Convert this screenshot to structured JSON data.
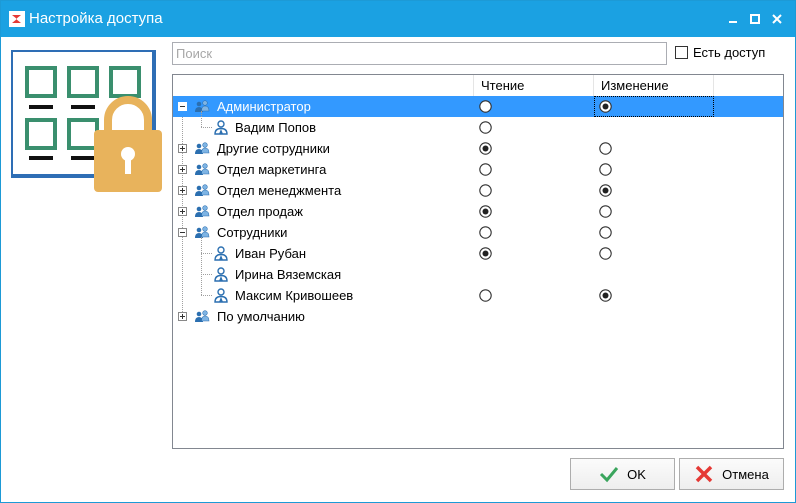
{
  "window": {
    "title": "Настройка доступа"
  },
  "search": {
    "placeholder": "Поиск",
    "value": ""
  },
  "access_filter": {
    "label": "Есть доступ",
    "checked": false
  },
  "grid": {
    "columns": [
      "",
      "Чтение",
      "Изменение"
    ],
    "rows": [
      {
        "label": "Администратор",
        "type": "group",
        "level": 0,
        "expander": "minus",
        "read": "off",
        "write": "on",
        "selected": true
      },
      {
        "label": "Вадим Попов",
        "type": "user",
        "level": 1,
        "expander": "none",
        "read": "off",
        "write": "none",
        "selected": false
      },
      {
        "label": "Другие сотрудники",
        "type": "group",
        "level": 0,
        "expander": "plus",
        "read": "on",
        "write": "off",
        "selected": false
      },
      {
        "label": "Отдел маркетинга",
        "type": "group",
        "level": 0,
        "expander": "plus",
        "read": "off",
        "write": "off",
        "selected": false
      },
      {
        "label": "Отдел менеджмента",
        "type": "group",
        "level": 0,
        "expander": "plus",
        "read": "off",
        "write": "on",
        "selected": false
      },
      {
        "label": "Отдел продаж",
        "type": "group",
        "level": 0,
        "expander": "plus",
        "read": "on",
        "write": "off",
        "selected": false
      },
      {
        "label": "Сотрудники",
        "type": "group",
        "level": 0,
        "expander": "minus",
        "read": "off",
        "write": "off",
        "selected": false
      },
      {
        "label": "Иван Рубан",
        "type": "user",
        "level": 1,
        "expander": "none",
        "read": "on",
        "write": "off",
        "selected": false
      },
      {
        "label": "Ирина Вяземская",
        "type": "user",
        "level": 1,
        "expander": "none",
        "read": "none",
        "write": "none",
        "selected": false
      },
      {
        "label": "Максим Кривошеев",
        "type": "user",
        "level": 1,
        "expander": "none",
        "read": "off",
        "write": "on",
        "selected": false
      },
      {
        "label": "По умолчанию",
        "type": "group",
        "level": 0,
        "expander": "plus",
        "read": "none",
        "write": "none",
        "selected": false
      }
    ]
  },
  "buttons": {
    "ok_label": "OK",
    "cancel_label": "Отмена"
  },
  "colors": {
    "titlebar": "#1ba1e2",
    "selection": "#3399ff",
    "lock": "#e8b35c",
    "tile_green": "#3a8f6e",
    "user_icon": "#2b6fb0"
  }
}
